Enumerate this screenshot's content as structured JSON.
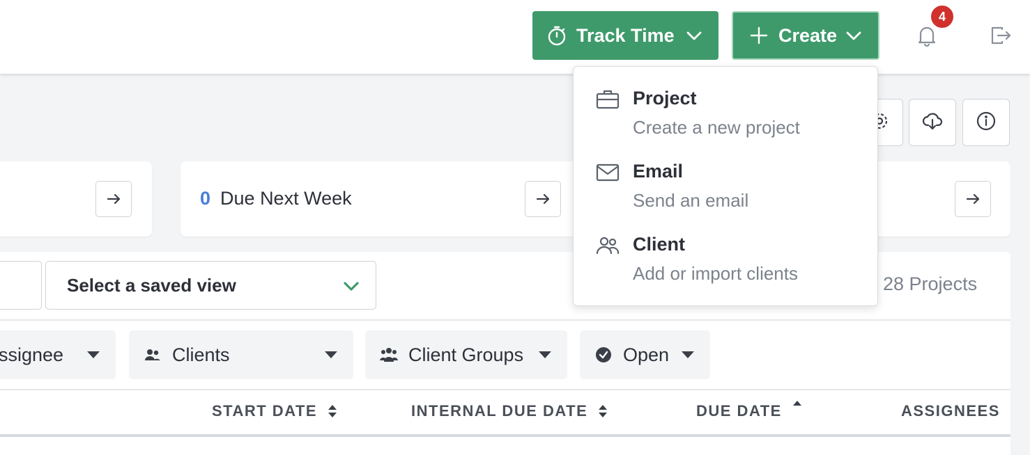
{
  "header": {
    "track_time_label": "Track Time",
    "create_label": "Create",
    "notification_count": "4"
  },
  "cards": [
    {
      "count": "",
      "label": ""
    },
    {
      "count": "0",
      "label": "Due Next Week"
    },
    {
      "count": "",
      "label": ""
    }
  ],
  "list": {
    "saved_view_label": "Select a saved view",
    "project_count": "28 Projects",
    "filters": {
      "assignee": "Assignee",
      "clients": "Clients",
      "client_groups": "Client Groups",
      "open": "Open"
    },
    "columns": {
      "start_date": "START DATE",
      "internal_due_date": "INTERNAL DUE DATE",
      "due_date": "DUE DATE",
      "assignees": "ASSIGNEES"
    }
  },
  "create_menu": {
    "items": [
      {
        "icon": "briefcase-icon",
        "title": "Project",
        "description": "Create a new project"
      },
      {
        "icon": "mail-icon",
        "title": "Email",
        "description": "Send an email"
      },
      {
        "icon": "users-icon",
        "title": "Client",
        "description": "Add or import clients"
      }
    ]
  },
  "colors": {
    "accent_green": "#3f9a6b",
    "badge_red": "#d0312d",
    "count_blue": "#4a7fd6"
  }
}
